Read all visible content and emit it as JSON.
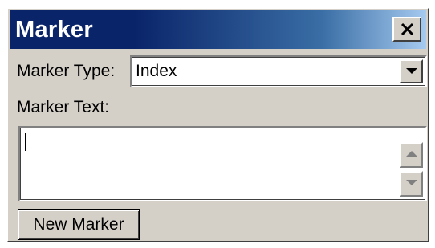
{
  "window": {
    "title": "Marker",
    "title_color": "#ffffff",
    "titlebar_colors": [
      "#0a246a",
      "#a6caf0"
    ],
    "close_icon": "close-icon"
  },
  "marker_type": {
    "label": "Marker Type:",
    "selected": "Index",
    "arrow_icon": "chevron-down-icon"
  },
  "marker_text": {
    "label": "Marker Text:",
    "value": "",
    "scroll_up_icon": "arrow-up-icon",
    "scroll_down_icon": "arrow-down-icon"
  },
  "new_marker_button": {
    "label": "New Marker"
  },
  "colors": {
    "face": "#d4d0c8",
    "disabled_arrow": "#808080"
  }
}
